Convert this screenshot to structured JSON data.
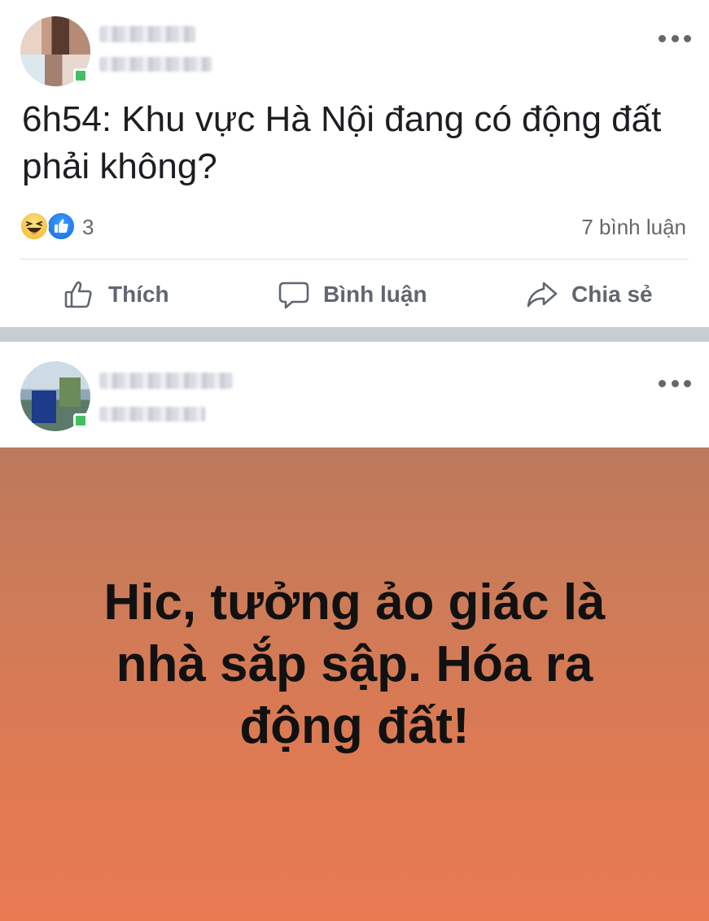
{
  "post1": {
    "text": "6h54: Khu vực Hà Nội đang có động đất phải không?",
    "reaction_count": "3",
    "comment_count": "7 bình luận",
    "reactions": [
      "haha-icon",
      "like-icon"
    ]
  },
  "actions": {
    "like_label": "Thích",
    "comment_label": "Bình luận",
    "share_label": "Chia sẻ"
  },
  "post2": {
    "text": "Hic, tưởng ảo giác là nhà sắp sập. Hóa ra động đất!",
    "background_colors": [
      "#bc7a5c",
      "#e87a52"
    ]
  },
  "colors": {
    "online": "#45bd62",
    "like_blue": "#1567e7",
    "muted_text": "#65676b"
  }
}
